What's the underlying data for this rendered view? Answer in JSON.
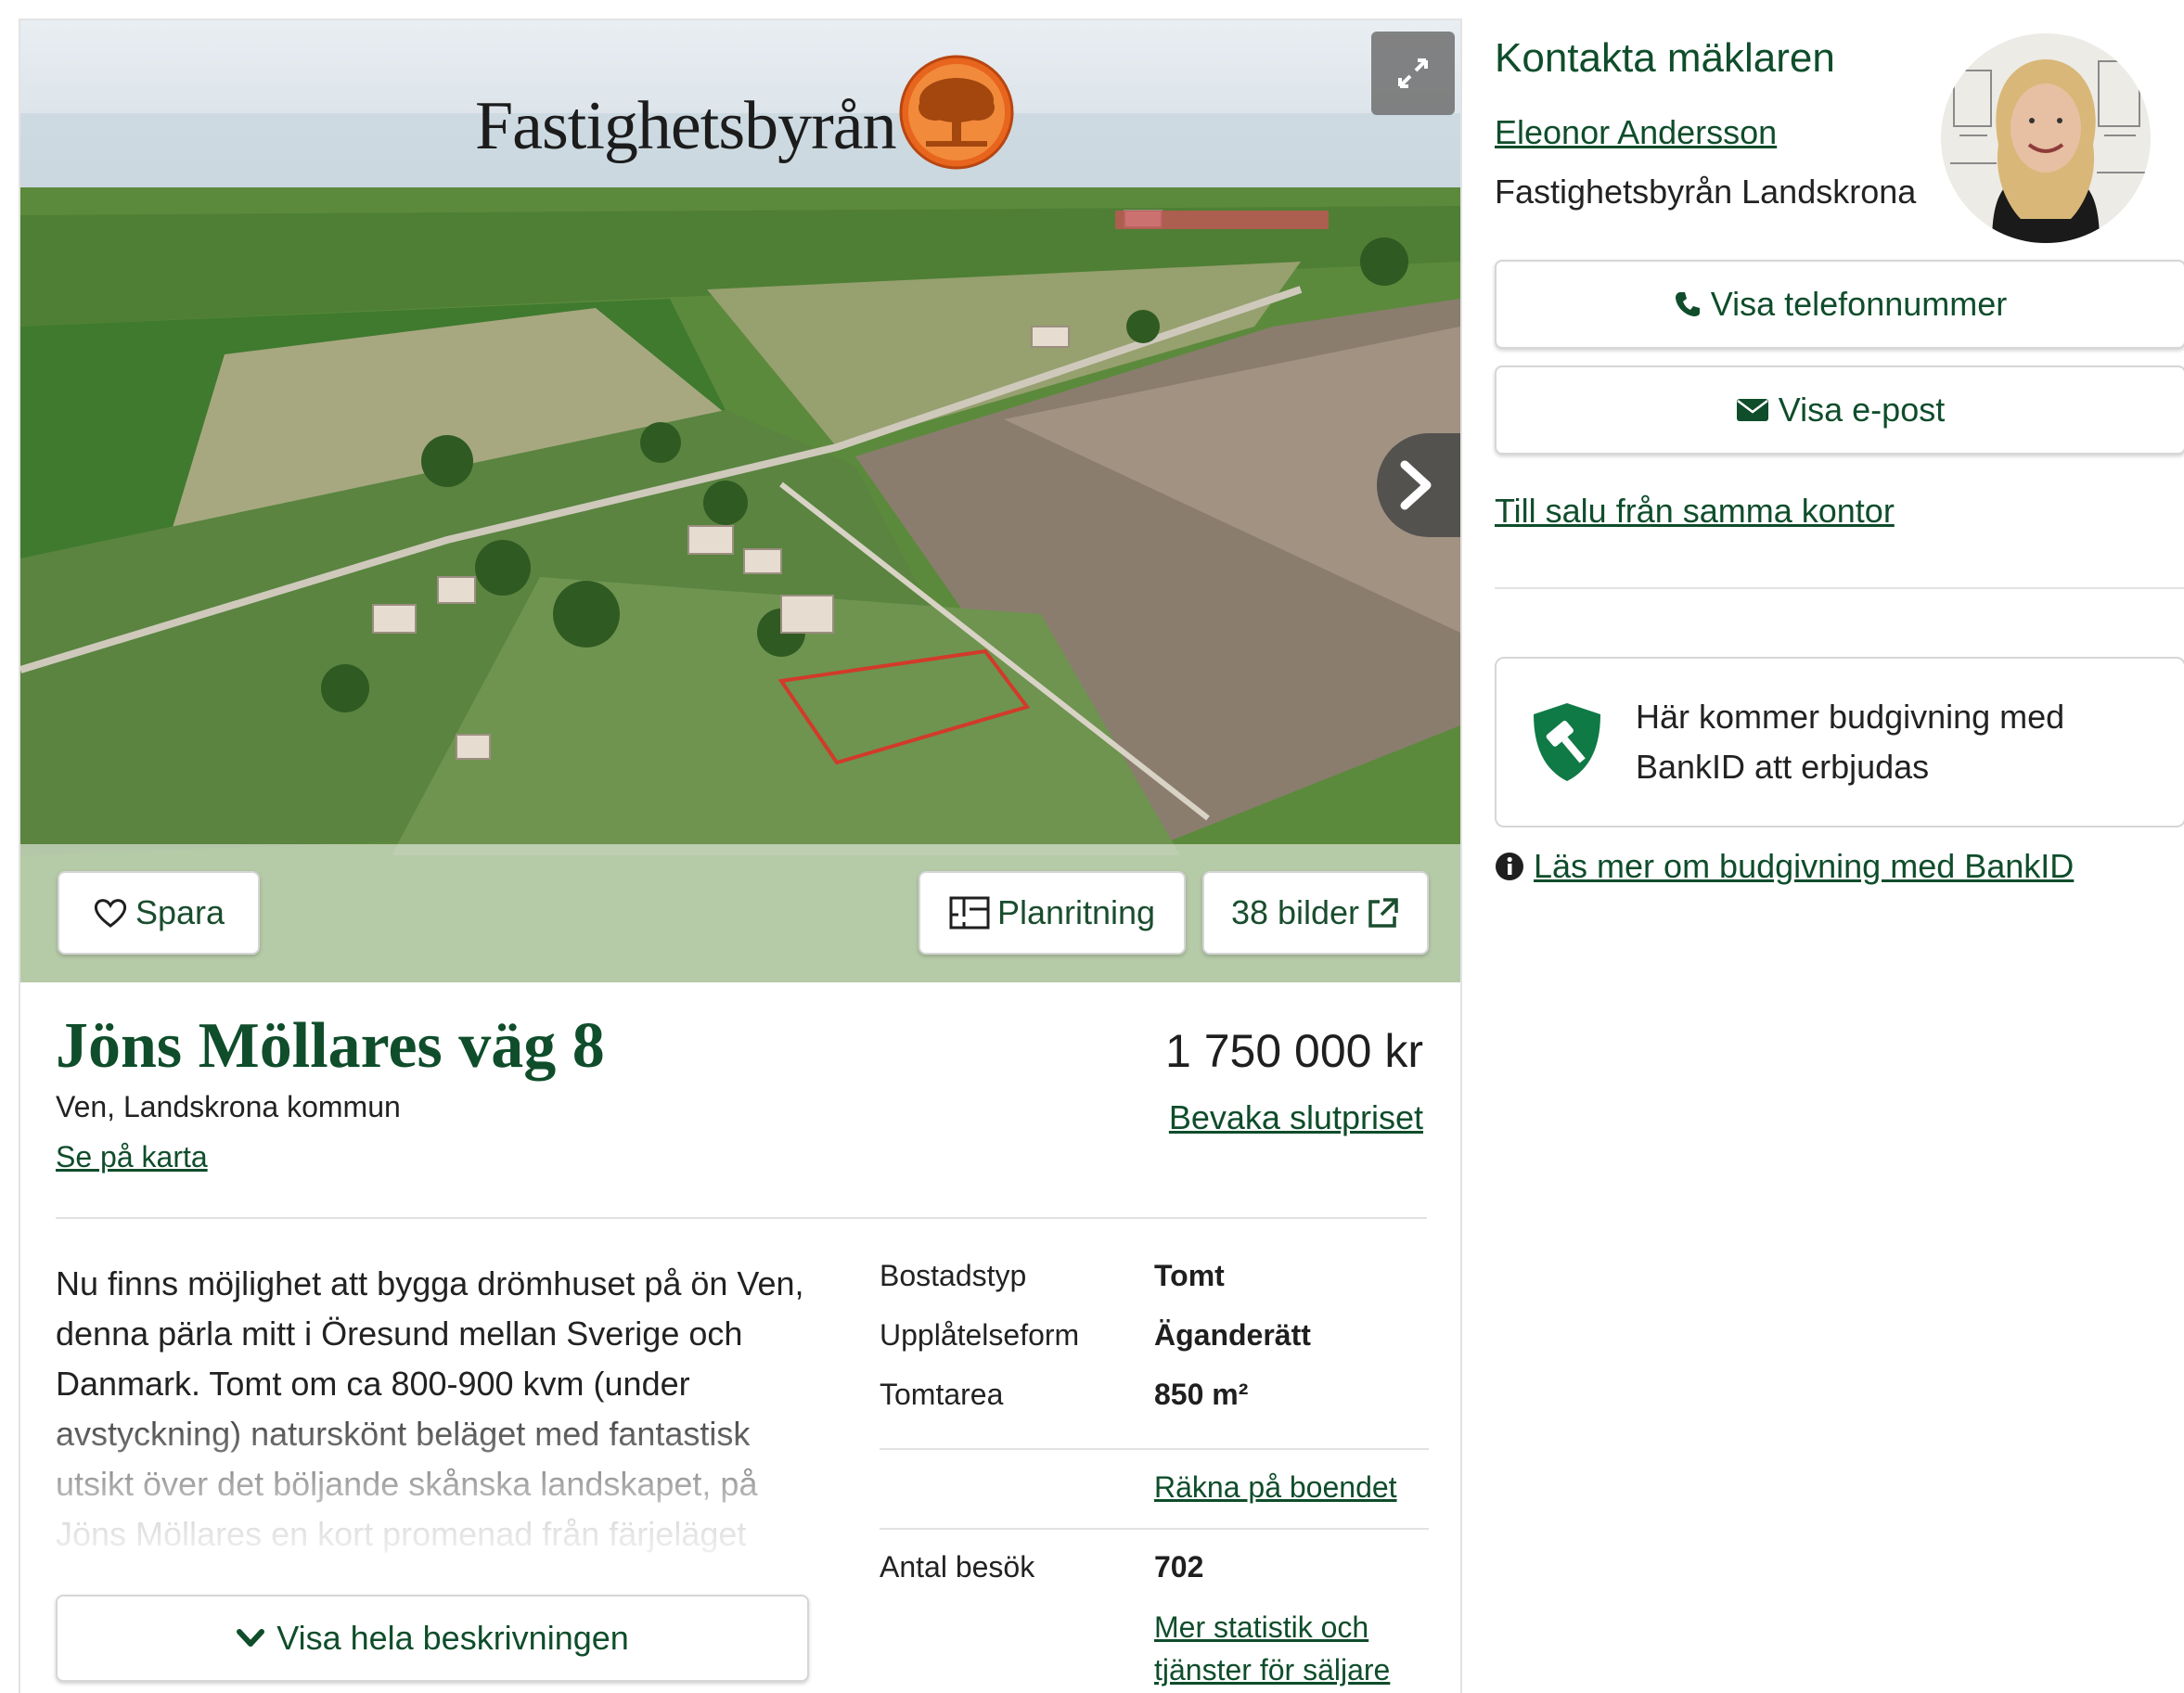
{
  "gallery": {
    "logo_text": "Fastighetsbyrån",
    "save_label": "Spara",
    "floorplan_label": "Planritning",
    "images_label": "38 bilder"
  },
  "property": {
    "title": "Jöns Möllares väg 8",
    "location": "Ven, Landskrona kommun",
    "map_link": "Se på karta",
    "price": "1 750 000 kr",
    "watch_price_link": "Bevaka slutpriset",
    "description": "Nu finns möjlighet att bygga drömhuset på ön Ven, denna pärla mitt i Öresund mellan Sverige och Danmark. Tomt om ca 800-900 kvm (under avstyckning) naturskönt beläget med fantastisk utsikt över det böljande skånska landskapet, på Jöns Möllares en kort promenad från färjeläget",
    "show_full_description": "Visa hela beskrivningen"
  },
  "facts": {
    "rows": [
      {
        "key": "Bostadstyp",
        "value": "Tomt"
      },
      {
        "key": "Upplåtelseform",
        "value": "Äganderätt"
      },
      {
        "key": "Tomtarea",
        "value": "850 m²"
      }
    ],
    "calc_link": "Räkna på boendet",
    "visits_label": "Antal besök",
    "visits_value": "702",
    "stats_link_line1": "Mer statistik och",
    "stats_link_line2": "tjänster för säljare"
  },
  "contact": {
    "heading": "Kontakta mäklaren",
    "agent_name": "Eleonor Andersson",
    "office": "Fastighetsbyrån Landskrona",
    "phone_button": "Visa telefonnummer",
    "email_button": "Visa e-post",
    "office_listings_link": "Till salu från samma kontor"
  },
  "bankid": {
    "notice": "Här kommer budgivning med BankID att erbjudas",
    "info_link": "Läs mer om budgivning med BankID"
  },
  "colors": {
    "brand_green": "#0f4d2b",
    "button_green": "#11693b",
    "logo_orange": "#e8651d"
  }
}
